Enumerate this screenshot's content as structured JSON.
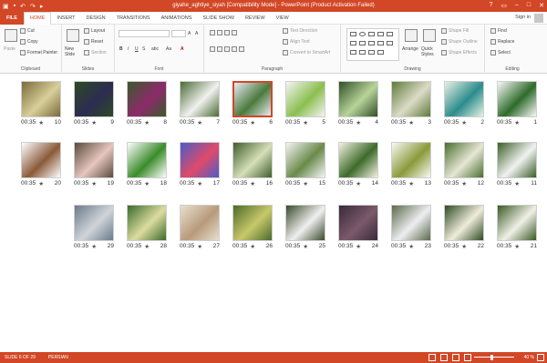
{
  "titlebar": {
    "title": "giyahe_aghtiye_siyah [Compatibility Mode] - PowerPoint (Product Activation Failed)",
    "quick_access": [
      "save-icon",
      "undo-icon",
      "redo-icon",
      "start-icon"
    ],
    "controls": [
      "?",
      "▭",
      "–",
      "□",
      "✕"
    ]
  },
  "tabs": {
    "file": "FILE",
    "items": [
      "HOME",
      "INSERT",
      "DESIGN",
      "TRANSITIONS",
      "ANIMATIONS",
      "SLIDE SHOW",
      "REVIEW",
      "VIEW"
    ],
    "active": "HOME",
    "signin": "Sign in"
  },
  "ribbon": {
    "clipboard": {
      "label": "Clipboard",
      "paste": "Paste",
      "cut": "Cut",
      "copy": "Copy",
      "format_painter": "Format Painter"
    },
    "slides": {
      "label": "Slides",
      "new_slide": "New Slide",
      "layout": "Layout",
      "reset": "Reset",
      "section": "Section"
    },
    "font": {
      "label": "Font",
      "size_a_up": "A",
      "size_a_down": "A",
      "bold": "B",
      "italic": "I",
      "underline": "U",
      "strike": "S",
      "spacing": "abc",
      "aa": "Aa"
    },
    "paragraph": {
      "label": "Paragraph",
      "text_direction": "Text Direction",
      "align_text": "Align Text",
      "convert": "Convert to SmartArt"
    },
    "drawing": {
      "label": "Drawing",
      "arrange": "Arrange",
      "quick_styles": "Quick Styles",
      "shape_fill": "Shape Fill",
      "shape_outline": "Shape Outline",
      "shape_effects": "Shape Effects"
    },
    "editing": {
      "label": "Editing",
      "find": "Find",
      "replace": "Replace",
      "select": "Select"
    }
  },
  "slides": [
    {
      "num": "1",
      "time": "00:35",
      "colors": [
        "#fafafa",
        "#2e6b2a"
      ]
    },
    {
      "num": "2",
      "time": "00:35",
      "colors": [
        "#e8f2e4",
        "#2b8c8c"
      ]
    },
    {
      "num": "3",
      "time": "00:35",
      "colors": [
        "#5e7a3a",
        "#dcdcc8"
      ]
    },
    {
      "num": "4",
      "time": "00:35",
      "colors": [
        "#2f4f26",
        "#b8d49a"
      ]
    },
    {
      "num": "5",
      "time": "00:35",
      "colors": [
        "#f4f4f4",
        "#8bbf4f"
      ]
    },
    {
      "num": "6",
      "time": "00:35",
      "colors": [
        "#e9eaf3",
        "#4b7a3c"
      ]
    },
    {
      "num": "7",
      "time": "00:35",
      "colors": [
        "#4a6b35",
        "#f1f1ee"
      ]
    },
    {
      "num": "8",
      "time": "00:35",
      "colors": [
        "#3b5a2a",
        "#8c2a6a"
      ]
    },
    {
      "num": "9",
      "time": "00:35",
      "colors": [
        "#2d4a24",
        "#2c2c50"
      ]
    },
    {
      "num": "10",
      "time": "00:35",
      "colors": [
        "#7a6a3a",
        "#d8cf9a"
      ]
    },
    {
      "num": "11",
      "time": "00:35",
      "colors": [
        "#3a5f26",
        "#f2f2f2"
      ]
    },
    {
      "num": "12",
      "time": "00:35",
      "colors": [
        "#4a6e30",
        "#e6e6d4"
      ]
    },
    {
      "num": "13",
      "time": "00:35",
      "colors": [
        "#fafaf5",
        "#8a9a3a"
      ]
    },
    {
      "num": "14",
      "time": "00:35",
      "colors": [
        "#f4f1e2",
        "#3d6a2a"
      ]
    },
    {
      "num": "15",
      "time": "00:35",
      "colors": [
        "#f5f5f5",
        "#6a8a4a"
      ]
    },
    {
      "num": "16",
      "time": "00:35",
      "colors": [
        "#3f5d2a",
        "#d5dfb8"
      ]
    },
    {
      "num": "17",
      "time": "00:35",
      "colors": [
        "#4a5cc8",
        "#e04a6a"
      ]
    },
    {
      "num": "18",
      "time": "00:35",
      "colors": [
        "#ffffff",
        "#3b8c2a"
      ]
    },
    {
      "num": "19",
      "time": "00:35",
      "colors": [
        "#5a4a3a",
        "#e6c6c0"
      ]
    },
    {
      "num": "20",
      "time": "00:35",
      "colors": [
        "#ffffff",
        "#8a5a3a"
      ]
    },
    {
      "num": "21",
      "time": "00:35",
      "colors": [
        "#3a5a26",
        "#f0f0e6"
      ]
    },
    {
      "num": "22",
      "time": "00:35",
      "colors": [
        "#2d4a22",
        "#f0ecdc"
      ]
    },
    {
      "num": "23",
      "time": "00:35",
      "colors": [
        "#5a6a4a",
        "#eeeef2"
      ]
    },
    {
      "num": "24",
      "time": "00:35",
      "colors": [
        "#3a2a3a",
        "#7a5a6a"
      ]
    },
    {
      "num": "25",
      "time": "00:35",
      "colors": [
        "#3a4a2a",
        "#f0f0f0"
      ]
    },
    {
      "num": "26",
      "time": "00:35",
      "colors": [
        "#4a6a2a",
        "#c8c86a"
      ]
    },
    {
      "num": "27",
      "time": "00:35",
      "colors": [
        "#e8e0d0",
        "#b89a7a"
      ]
    },
    {
      "num": "28",
      "time": "00:35",
      "colors": [
        "#3a6a2a",
        "#dcdca0"
      ]
    },
    {
      "num": "29",
      "time": "00:35",
      "colors": [
        "#6a7a8a",
        "#d0d4da"
      ]
    }
  ],
  "selected_slide": "6",
  "statusbar": {
    "slide_info": "SLIDE 6 OF 29",
    "language": "PERSIAN",
    "zoom": "40 %"
  },
  "accent": "#d24726"
}
